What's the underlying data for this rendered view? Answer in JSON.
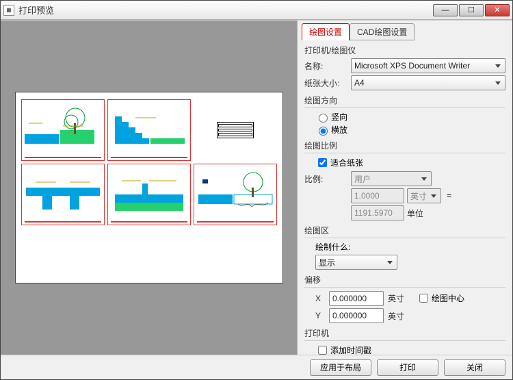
{
  "window": {
    "title": "打印预览"
  },
  "tabs": {
    "t1": "绘图设置",
    "t2": "CAD绘图设置"
  },
  "printer": {
    "header": "打印机/绘图仪",
    "name_label": "名称:",
    "name_value": "Microsoft XPS Document Writer",
    "paper_label": "纸张大小:",
    "paper_value": "A4"
  },
  "orient": {
    "header": "绘图方向",
    "portrait": "竖向",
    "landscape": "横放"
  },
  "scale": {
    "header": "绘图比例",
    "fit_label": "适合纸张",
    "ratio_label": "比例:",
    "ratio_value": "用户",
    "val1": "1.0000",
    "unit1": "英寸",
    "eq": "=",
    "val2": "1191.5970",
    "unit2": "单位"
  },
  "area": {
    "header": "绘图区",
    "what_label": "绘制什么:",
    "what_value": "显示"
  },
  "offset": {
    "header": "偏移",
    "x_label": "X",
    "y_label": "Y",
    "x_value": "0.000000",
    "y_value": "0.000000",
    "unit": "英寸",
    "center_label": "绘图中心"
  },
  "printer2": {
    "header": "打印机",
    "timegap_label": "添加时间戳"
  },
  "buttons": {
    "apply": "应用于布局",
    "print": "打印",
    "close": "关闭"
  }
}
